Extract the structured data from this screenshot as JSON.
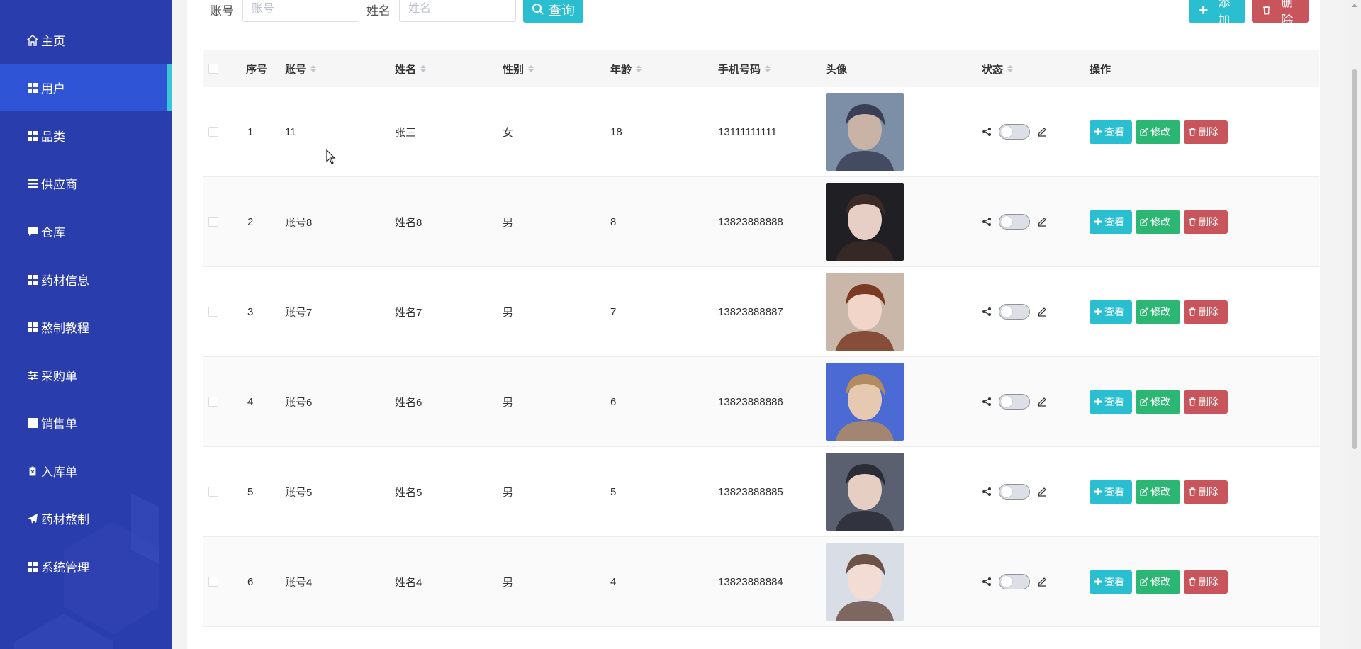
{
  "sidebar": {
    "bg_color": "#2a3dad",
    "active_color": "#2f54d6",
    "accent_color": "#38c7d9",
    "items": [
      {
        "label": "主页",
        "icon": "home-icon"
      },
      {
        "label": "用户",
        "icon": "grid-icon",
        "active": true
      },
      {
        "label": "品类",
        "icon": "grid-icon"
      },
      {
        "label": "供应商",
        "icon": "list-icon"
      },
      {
        "label": "仓库",
        "icon": "comment-icon"
      },
      {
        "label": "药材信息",
        "icon": "grid-icon"
      },
      {
        "label": "熬制教程",
        "icon": "grid-icon"
      },
      {
        "label": "采购单",
        "icon": "sliders-icon"
      },
      {
        "label": "销售单",
        "icon": "chart-icon"
      },
      {
        "label": "入库单",
        "icon": "clipboard-icon"
      },
      {
        "label": "药材熬制",
        "icon": "send-icon"
      },
      {
        "label": "系统管理",
        "icon": "grid-icon"
      }
    ]
  },
  "search": {
    "account_label": "账号",
    "account_placeholder": "账号",
    "name_label": "姓名",
    "name_placeholder": "姓名",
    "query_label": "查询"
  },
  "toolbar": {
    "add_label": "添加",
    "delete_label": "删除"
  },
  "table": {
    "headers": {
      "index": "序号",
      "account": "账号",
      "name": "姓名",
      "gender": "性别",
      "age": "年龄",
      "phone": "手机号码",
      "avatar": "头像",
      "status": "状态",
      "actions": "操作"
    },
    "rows": [
      {
        "index": "1",
        "account": "11",
        "name": "张三",
        "gender": "女",
        "age": "18",
        "phone": "13111111111"
      },
      {
        "index": "2",
        "account": "账号8",
        "name": "姓名8",
        "gender": "男",
        "age": "8",
        "phone": "13823888888"
      },
      {
        "index": "3",
        "account": "账号7",
        "name": "姓名7",
        "gender": "男",
        "age": "7",
        "phone": "13823888887"
      },
      {
        "index": "4",
        "account": "账号6",
        "name": "姓名6",
        "gender": "男",
        "age": "6",
        "phone": "13823888886"
      },
      {
        "index": "5",
        "account": "账号5",
        "name": "姓名5",
        "gender": "男",
        "age": "5",
        "phone": "13823888885"
      },
      {
        "index": "6",
        "account": "账号4",
        "name": "姓名4",
        "gender": "男",
        "age": "4",
        "phone": "13823888884"
      }
    ],
    "row_actions": {
      "view": "查看",
      "edit": "修改",
      "delete": "删除"
    }
  }
}
